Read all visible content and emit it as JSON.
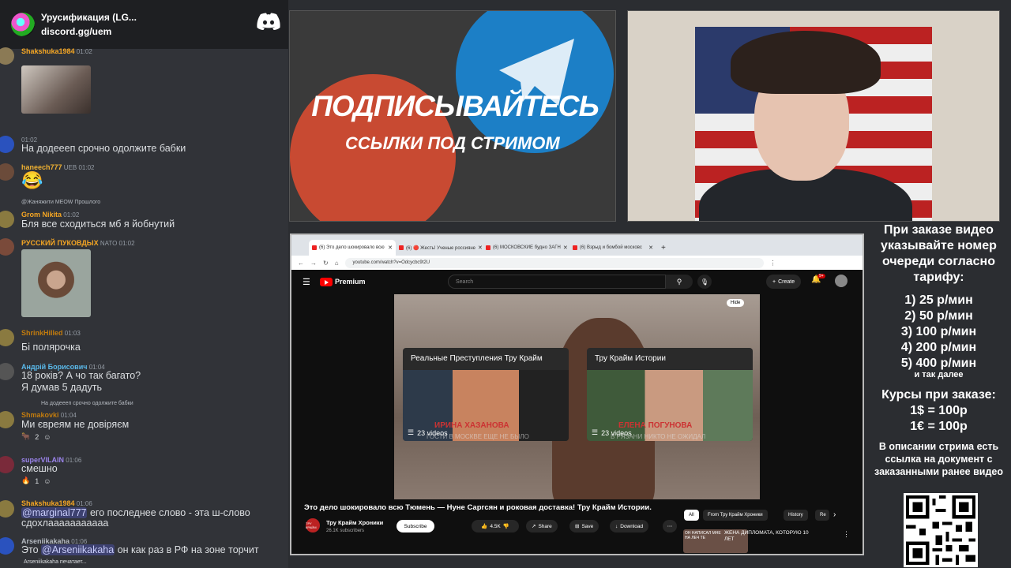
{
  "server": {
    "name": "Урусификация (LG...",
    "invite": "discord.gg/uem"
  },
  "chat": [
    {
      "user": "Shakshuka1984",
      "time": "01:02",
      "text": "",
      "has_image": true
    },
    {
      "user": "",
      "time": "01:02",
      "text": "На додеееп срочно одолжите бабки",
      "name_color": "#b5bac1"
    },
    {
      "user": "haneech777",
      "badge": "UEB",
      "time": "01:02",
      "text": "😂",
      "name_color": "#f0b232"
    },
    {
      "reply": "@Жаняжити MEOW Прошлого",
      "user": "Grom Nikita",
      "time": "01:02",
      "text": "Бля все сходиться мб я йобнутий",
      "name_color": "#f5a623"
    },
    {
      "user": "РУССКИЙ ПУКОВДЫХ",
      "badge": "NATO",
      "time": "01:02",
      "text": "",
      "has_image": true,
      "name_color": "#f5a623"
    },
    {
      "user": "ShrinkHilled",
      "time": "01:03",
      "text": "Бі полярочка",
      "name_color": "#c27c0e"
    },
    {
      "user": "Андрій Борисович",
      "time": "01:04",
      "text": "18 років? А чо так багато?",
      "text2": "Я думав 5 дадуть",
      "name_color": "#5ab9ea"
    },
    {
      "reply": "На додеееп срочно одолжите бабки",
      "user": "Shmakovki",
      "time": "01:04",
      "text": "Ми євреям не довіряєм",
      "reaction": "2",
      "name_color": "#c27c0e"
    },
    {
      "user": "superVILAIN",
      "time": "01:06",
      "text": "смешно",
      "reaction": "1",
      "name_color": "#9b84ec"
    },
    {
      "user": "Shakshuka1984",
      "time": "01:06",
      "mention": "@marginal777",
      "text": " его последнее слово - эта ш-слово",
      "text2": "сдохлааааааааааа",
      "name_color": "#f5a623"
    },
    {
      "user": "Arseniikakaha",
      "time": "01:06",
      "prefix": "Это ",
      "mention": "@Arseniikakaha",
      "text": " он как раз в РФ на зоне торчит",
      "name_color": "#b5bac1"
    }
  ],
  "typing": "Arseniikakaha печатает...",
  "banner": {
    "title": "ПОДПИСЫВАЙТЕСЬ",
    "subtitle": "ССЫЛКИ ПОД СТРИМОМ"
  },
  "browser": {
    "tabs": [
      {
        "label": "(6) Это дело шокировало всю",
        "active": true
      },
      {
        "label": "(6) 🔴 Жесть! Ученые россияне"
      },
      {
        "label": "(6) МОСКОВСКИЕ будно ЗАГН"
      },
      {
        "label": "(6) Взрыд и бомбой московс"
      }
    ],
    "url": "youtube.com/watch?v=Odcycbc9t2U",
    "premium": "Premium",
    "search_placeholder": "Search",
    "create": "Create",
    "notif_count": "9+",
    "hide": "Hide",
    "endcards": [
      {
        "title": "Реальные Преступления Тру Крайм",
        "count": "23 videos",
        "red": "ИРИНА ХАЗАНОВА",
        "overlay": "ГОСТИ В МОСКВЕ ЕЩЕ НЕ БЫЛО"
      },
      {
        "title": "Тру Крайм Истории",
        "count": "23 videos",
        "red": "ЕЛЕНА ПОГУНОВА",
        "overlay": "В РЯЗАНИ НИКТО НЕ ОЖИДАЛ"
      }
    ],
    "video_title": "Это дело шокировало всю Тюмень — Нуне Саргсян и роковая доставка! Тру Крайм Истории.",
    "channel": {
      "avatar": "ТРУ КРАЙМ",
      "name": "Тру Крайм Хроники",
      "subs": "26.1K subscribers"
    },
    "subscribe": "Subscribe",
    "likes": "4.5K",
    "share": "Share",
    "save": "Save",
    "download": "Download",
    "chips": [
      "All",
      "From Тру Крайм Хроники",
      "History",
      "Re"
    ],
    "rec_title": "ЖЕНА ДИПЛОМАТА, КОТОРУЮ 10 ЛЕТ",
    "rec_thumb_text": "ОН НАПИСАЛ МНЕ НА ЛЕЧ ТЕ"
  },
  "info": {
    "order": "При заказе видео указывайте номер очереди согласно тарифу:",
    "prices": [
      "1) 25 р/мин",
      "2) 50 р/мин",
      "3) 100 р/мин",
      "4) 200 р/мин",
      "5) 400 р/мин"
    ],
    "etc": "и так далее",
    "rates_title": "Курсы при заказе:",
    "rates": [
      "1$ = 100р",
      "1€ = 100р"
    ],
    "desc": "В описании стрима есть ссылка на документ с заказанными ранее видео"
  },
  "colors": {
    "discord_bg": "#313338",
    "yt_red": "#ff0000",
    "telegram_blue": "#1c7fc6",
    "rutube_red": "#c84a32"
  }
}
